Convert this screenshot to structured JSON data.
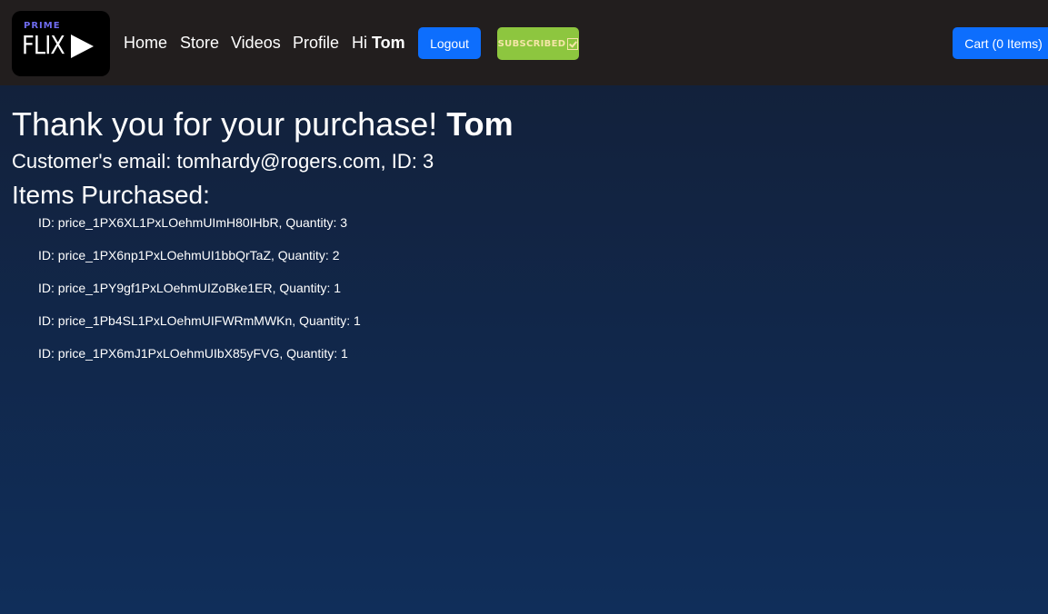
{
  "logo": {
    "line1": "PRIME",
    "line2": "FLIX"
  },
  "nav": {
    "links": [
      "Home",
      "Store",
      "Videos",
      "Profile"
    ],
    "greeting_prefix": "Hi",
    "user_name": "Tom",
    "logout_label": "Logout",
    "subscribed_label": "SUBSCRIBED",
    "cart_label": "Cart (0 Items)"
  },
  "main": {
    "thank_you_text": "Thank you for your purchase!",
    "customer_name": "Tom",
    "email_line": "Customer's email: tomhardy@rogers.com, ID: 3",
    "items_title": "Items Purchased:",
    "items": [
      "ID: price_1PX6XL1PxLOehmUImH80IHbR, Quantity: 3",
      "ID: price_1PX6np1PxLOehmUI1bbQrTaZ, Quantity: 2",
      "ID: price_1PY9gf1PxLOehmUIZoBke1ER, Quantity: 1",
      "ID: price_1Pb4SL1PxLOehmUIFWRmMWKn, Quantity: 1",
      "ID: price_1PX6mJ1PxLOehmUIbX85yFVG, Quantity: 1"
    ]
  }
}
